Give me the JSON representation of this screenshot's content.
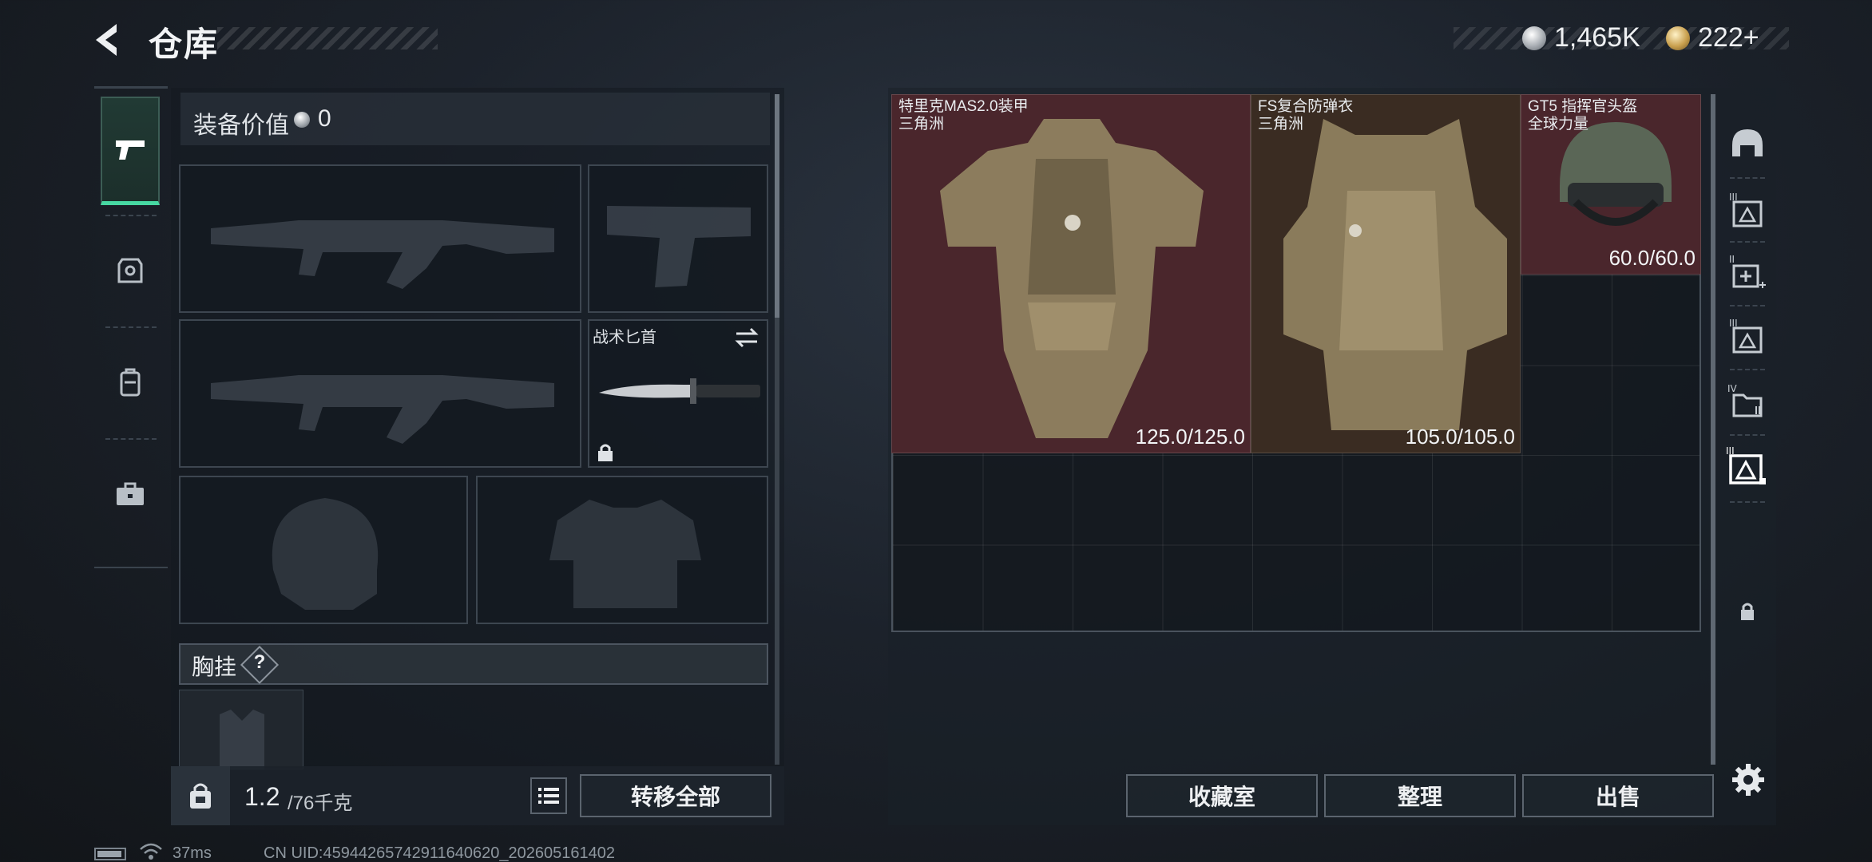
{
  "header": {
    "title": "仓库",
    "back_icon": "chevron-left-icon",
    "currency": [
      {
        "icon": "silver-coin-icon",
        "value": "1,465K"
      },
      {
        "icon": "gold-coin-icon",
        "value": "222+"
      }
    ]
  },
  "category_rail": {
    "items": [
      {
        "icon": "pistol-icon",
        "active": true
      },
      {
        "icon": "vest-badge-icon",
        "active": false
      },
      {
        "icon": "backpack-icon",
        "active": false
      },
      {
        "icon": "briefcase-icon",
        "active": false
      }
    ]
  },
  "loadout": {
    "equip_value_label": "装备价值",
    "equip_value": "0",
    "knife_slot_label": "战术匕首",
    "chest_rig_label": "胸挂",
    "chest_help": "?",
    "weight_value": "1.2",
    "weight_max": "/76千克",
    "transfer_all_label": "转移全部"
  },
  "stash": {
    "items": [
      {
        "name": "特里克MAS2.0装甲",
        "sub": "三角洲",
        "durability": "125.0/125.0",
        "color": "#4a262c"
      },
      {
        "name": "FS复合防弹衣",
        "sub": "三角洲",
        "durability": "105.0/105.0",
        "color": "#3a2c22"
      },
      {
        "name": "GT5 指挥官头盔",
        "sub": "全球力量",
        "durability": "60.0/60.0",
        "color": "#4a262c"
      }
    ],
    "filters": [
      {
        "icon": "helmet-filter-icon"
      },
      {
        "icon": "armor-tier-iii-filter-icon",
        "label": "III"
      },
      {
        "icon": "medkit-tier-ii-filter-icon",
        "label": "II"
      },
      {
        "icon": "armor-tier-iii-alt-filter-icon",
        "label": "III"
      },
      {
        "icon": "container-tier-iv-filter-icon",
        "label": "IV"
      },
      {
        "icon": "armor-tier-iii-active-filter-icon",
        "label": "III"
      },
      {
        "icon": "lock-filter-icon"
      }
    ],
    "collection_label": "收藏室",
    "sort_label": "整理",
    "sell_label": "出售"
  },
  "status_bar": {
    "ping": "37ms",
    "uid": "CN UID:4594426574291164062­0_202605161402"
  }
}
